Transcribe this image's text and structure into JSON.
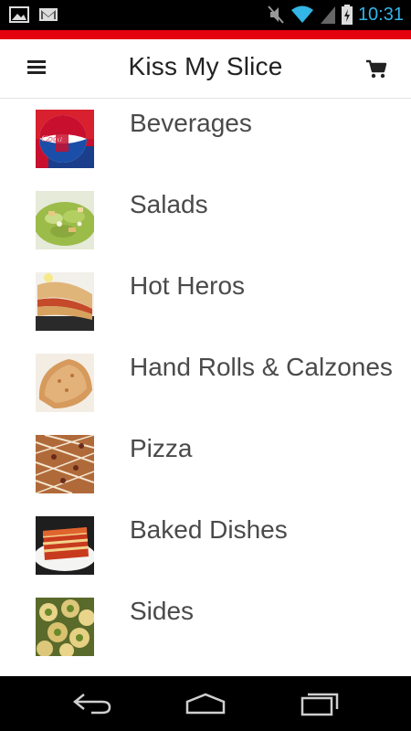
{
  "status_bar": {
    "time": "10:31",
    "icons": [
      "gallery-notification-icon",
      "gmail-notification-icon",
      "mute-icon",
      "wifi-icon",
      "signal-icon",
      "battery-charging-icon"
    ]
  },
  "colors": {
    "accent": "#e4000f",
    "status_blue": "#33b5e5",
    "text": "#4a4a4a"
  },
  "header": {
    "title": "Kiss My Slice",
    "menu_icon": "hamburger-menu-icon",
    "cart_icon": "shopping-cart-icon"
  },
  "categories": [
    {
      "label": "Beverages",
      "image": "beverages-thumbnail"
    },
    {
      "label": "Salads",
      "image": "salads-thumbnail"
    },
    {
      "label": "Hot Heros",
      "image": "hot-heros-thumbnail"
    },
    {
      "label": "Hand Rolls & Calzones",
      "image": "calzones-thumbnail"
    },
    {
      "label": "Pizza",
      "image": "pizza-thumbnail"
    },
    {
      "label": "Baked Dishes",
      "image": "baked-dishes-thumbnail"
    },
    {
      "label": "Sides",
      "image": "sides-thumbnail"
    }
  ],
  "nav_bar": {
    "icons": [
      "back-icon",
      "home-icon",
      "recent-apps-icon"
    ]
  }
}
